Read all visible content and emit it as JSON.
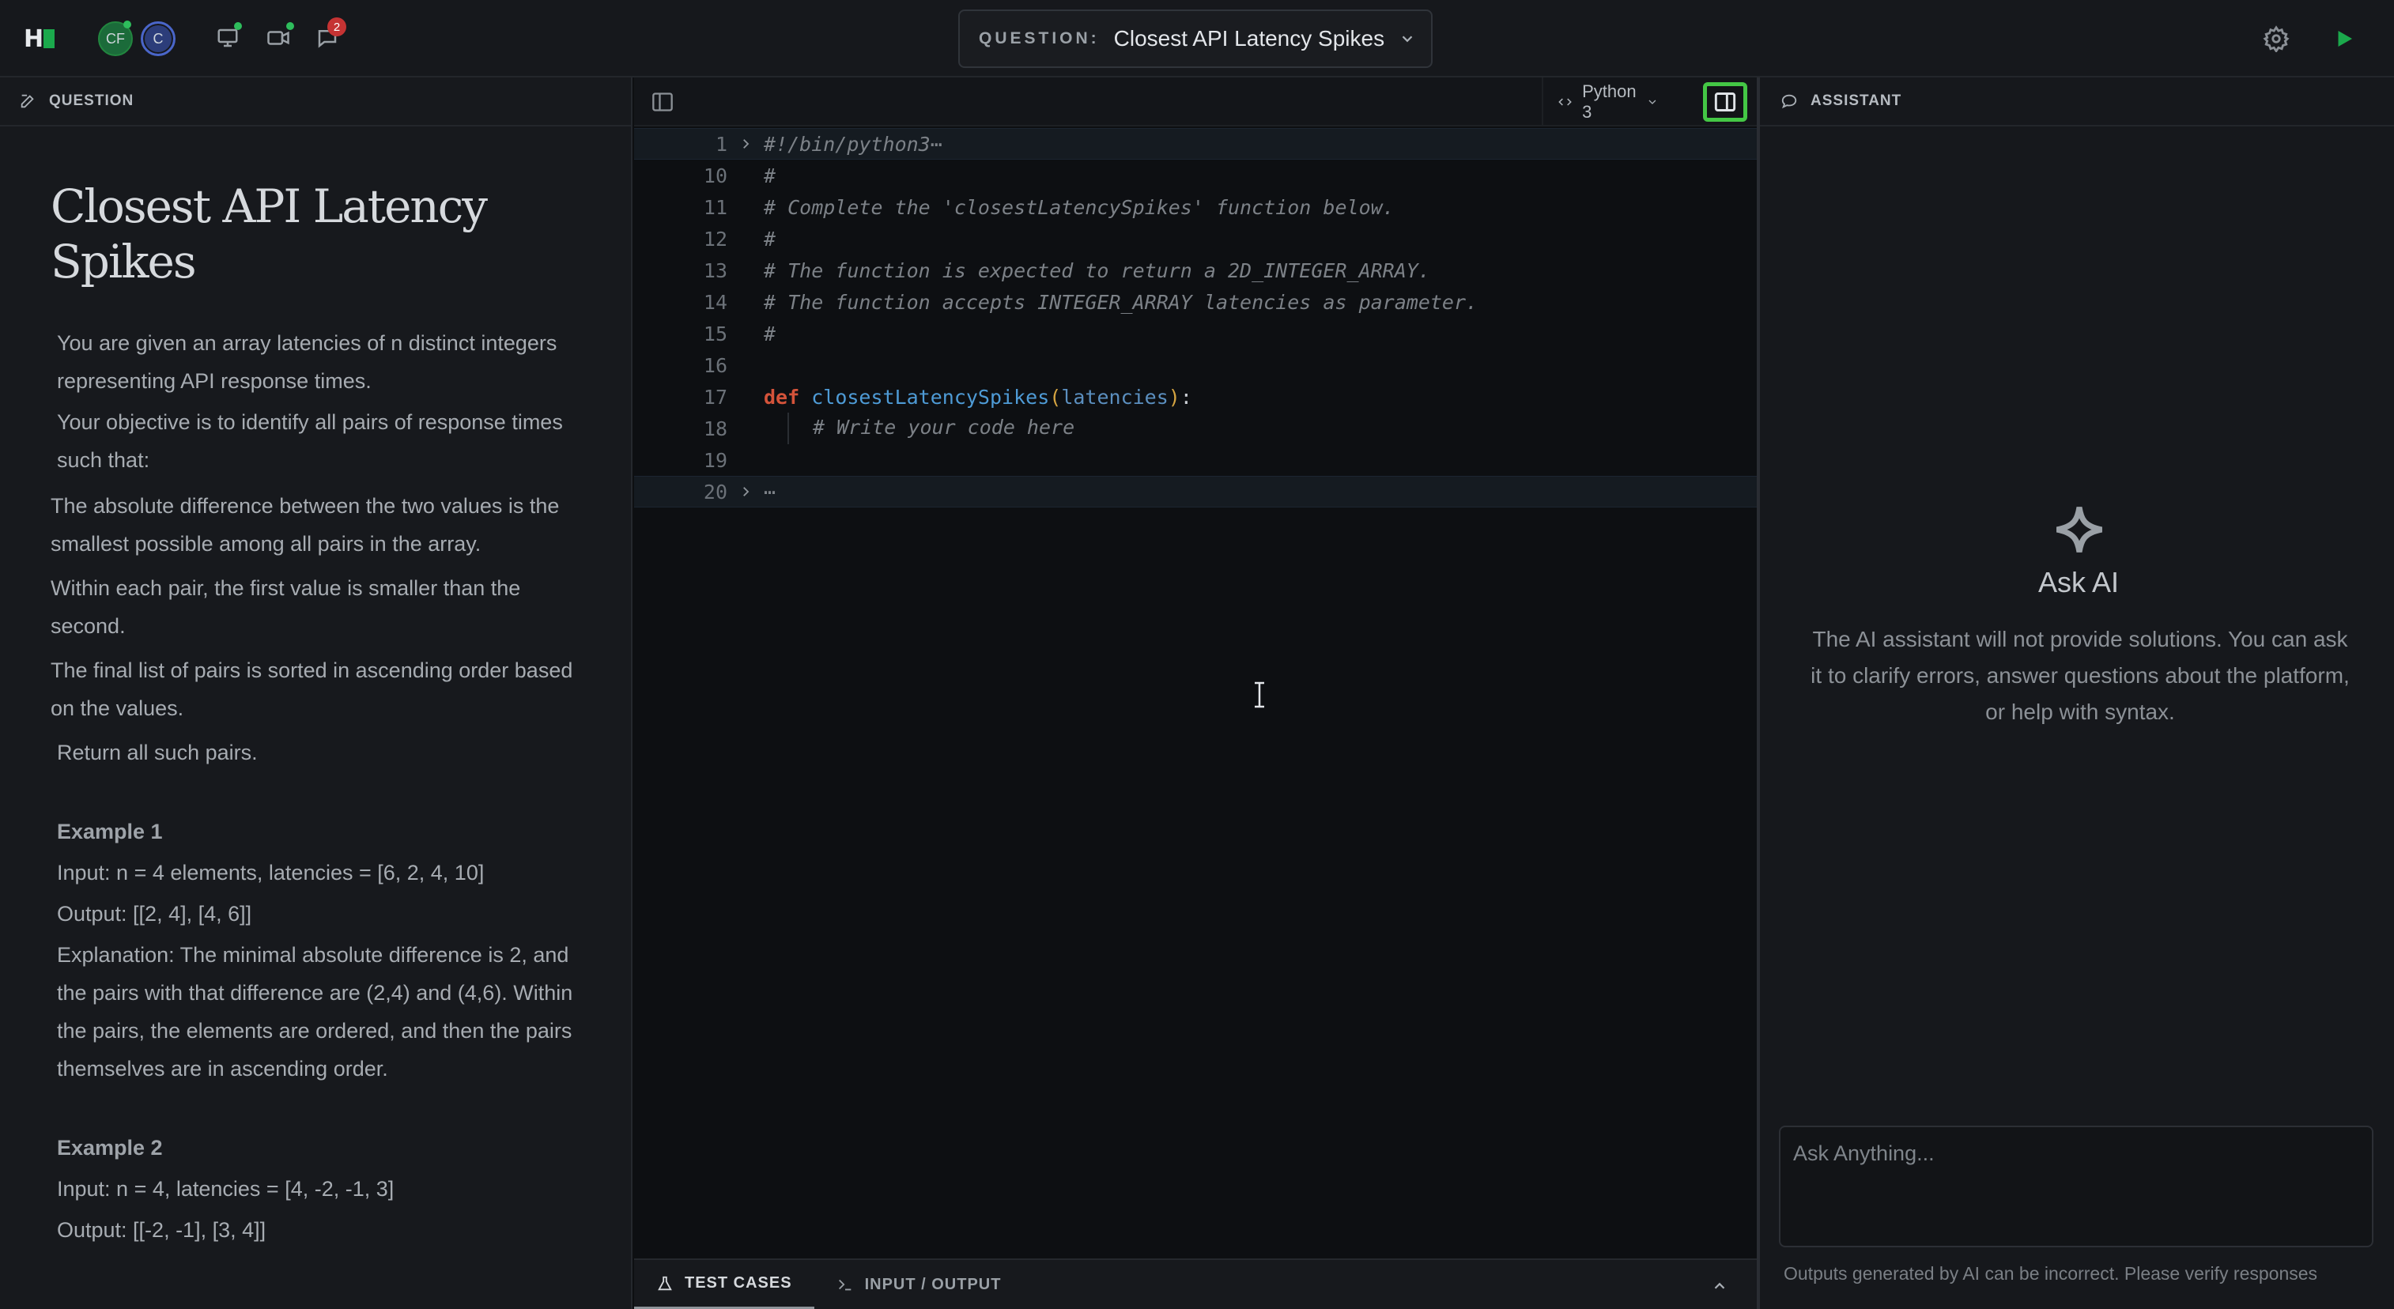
{
  "topbar": {
    "logo": "H",
    "avatars": [
      "CF",
      "C"
    ],
    "notification_count": "2",
    "question_select_label": "QUESTION:",
    "question_select_title": "Closest API Latency Spikes"
  },
  "left": {
    "header": "QUESTION",
    "title": "Closest API Latency Spikes",
    "paragraphs": {
      "p1": "You are given an array latencies of n distinct integers representing API response times.",
      "p2": "Your objective is to identify all pairs of response times such that:",
      "p3": "The absolute difference between the two values is the smallest possible among all pairs in the array.",
      "p4": "Within each pair, the first value is smaller than the second.",
      "p5": "The final list of pairs is sorted in ascending order based on the values.",
      "p6": "Return all such pairs."
    },
    "example1": {
      "heading": "Example 1",
      "input": "Input: n = 4 elements, latencies = [6, 2, 4, 10]",
      "output": "Output: [[2, 4], [4, 6]]",
      "explanation": "Explanation: The minimal absolute difference is 2, and the pairs with that difference are (2,4) and (4,6). Within the pairs, the elements are ordered, and then the pairs themselves are in ascending order."
    },
    "example2": {
      "heading": "Example 2",
      "input": "Input: n = 4, latencies = [4, -2, -1, 3]",
      "output": "Output: [[-2, -1], [3, 4]]"
    }
  },
  "editor": {
    "language": "Python 3",
    "lines": [
      {
        "n": "1",
        "text": "#!/bin/python3⋯",
        "cls": "cm",
        "fold": true,
        "active": true
      },
      {
        "n": "10",
        "text": "#",
        "cls": "cm"
      },
      {
        "n": "11",
        "text": "# Complete the 'closestLatencySpikes' function below.",
        "cls": "cm"
      },
      {
        "n": "12",
        "text": "#",
        "cls": "cm"
      },
      {
        "n": "13",
        "text": "# The function is expected to return a 2D_INTEGER_ARRAY.",
        "cls": "cm"
      },
      {
        "n": "14",
        "text": "# The function accepts INTEGER_ARRAY latencies as parameter.",
        "cls": "cm"
      },
      {
        "n": "15",
        "text": "#",
        "cls": "cm"
      },
      {
        "n": "16",
        "text": "",
        "cls": ""
      },
      {
        "n": "17",
        "text": "def closestLatencySpikes(latencies):",
        "cls": "def"
      },
      {
        "n": "18",
        "text": "# Write your code here",
        "cls": "cm-ind"
      },
      {
        "n": "19",
        "text": "",
        "cls": ""
      },
      {
        "n": "20",
        "text": "⋯",
        "cls": "cm",
        "fold": true,
        "active": true
      }
    ],
    "tabs": [
      "TEST CASES",
      "INPUT / OUTPUT"
    ]
  },
  "assistant": {
    "header": "ASSISTANT",
    "title": "Ask AI",
    "description": "The AI assistant will not provide solutions. You can ask it to clarify errors, answer questions about the platform, or help with syntax.",
    "input_placeholder": "Ask Anything...",
    "disclaimer": "Outputs generated by AI can be incorrect. Please verify responses"
  },
  "colors": {
    "accent_green": "#1ba94c",
    "highlight_border": "#44c745",
    "badge_red": "#c53333"
  }
}
